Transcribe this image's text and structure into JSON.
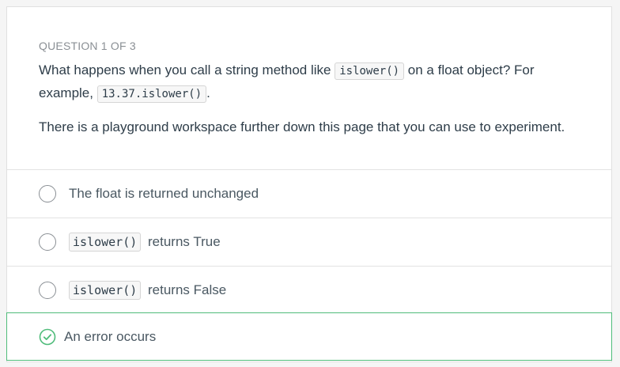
{
  "question": {
    "counter": "QUESTION 1 OF 3",
    "text_before_code1": "What happens when you call a string method like ",
    "code1": "islower()",
    "text_after_code1": " on a float object? For example, ",
    "code2": "13.37.islower()",
    "text_after_code2": ".",
    "hint": "There is a playground workspace further down this page that you can use to experiment."
  },
  "options": [
    {
      "code": "",
      "text": "The float is returned unchanged"
    },
    {
      "code": "islower()",
      "text": " returns True"
    },
    {
      "code": "islower()",
      "text": " returns False"
    },
    {
      "code": "",
      "text": "An error occurs",
      "selected": true,
      "correct": true
    }
  ],
  "colors": {
    "correct": "#4fbc7a",
    "text": "#2e3d49",
    "muted": "#8a8f94"
  }
}
